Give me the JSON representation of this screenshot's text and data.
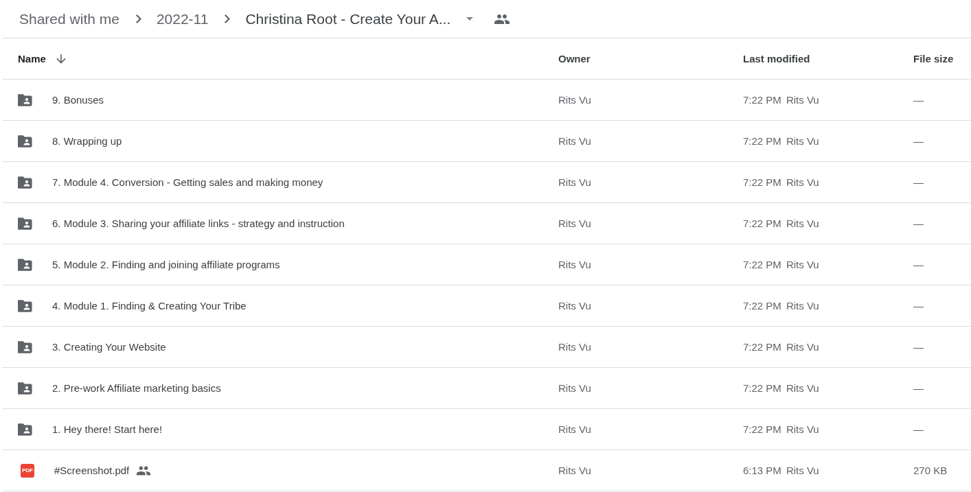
{
  "breadcrumbs": [
    {
      "label": "Shared with me",
      "current": false
    },
    {
      "label": "2022-11",
      "current": false
    },
    {
      "label": "Christina Root - Create Your A...",
      "current": true
    }
  ],
  "breadcrumb_shared": true,
  "table": {
    "columns": [
      {
        "label": "Name",
        "sorted": true
      },
      {
        "label": "Owner",
        "sorted": false
      },
      {
        "label": "Last modified",
        "sorted": false
      },
      {
        "label": "File size",
        "sorted": false
      }
    ],
    "rows": [
      {
        "kind": "folder",
        "name": "9. Bonuses",
        "shared": false,
        "owner": "Rits Vu",
        "modified_time": "7:22 PM",
        "modified_by": "Rits Vu",
        "size": "—"
      },
      {
        "kind": "folder",
        "name": "8. Wrapping up",
        "shared": false,
        "owner": "Rits Vu",
        "modified_time": "7:22 PM",
        "modified_by": "Rits Vu",
        "size": "—"
      },
      {
        "kind": "folder",
        "name": "7. Module 4. Conversion - Getting sales and making money",
        "shared": false,
        "owner": "Rits Vu",
        "modified_time": "7:22 PM",
        "modified_by": "Rits Vu",
        "size": "—"
      },
      {
        "kind": "folder",
        "name": "6. Module 3. Sharing your affiliate links - strategy and instruction",
        "shared": false,
        "owner": "Rits Vu",
        "modified_time": "7:22 PM",
        "modified_by": "Rits Vu",
        "size": "—"
      },
      {
        "kind": "folder",
        "name": "5. Module 2. Finding and joining affiliate programs",
        "shared": false,
        "owner": "Rits Vu",
        "modified_time": "7:22 PM",
        "modified_by": "Rits Vu",
        "size": "—"
      },
      {
        "kind": "folder",
        "name": "4. Module 1. Finding & Creating Your Tribe",
        "shared": false,
        "owner": "Rits Vu",
        "modified_time": "7:22 PM",
        "modified_by": "Rits Vu",
        "size": "—"
      },
      {
        "kind": "folder",
        "name": "3. Creating Your Website",
        "shared": false,
        "owner": "Rits Vu",
        "modified_time": "7:22 PM",
        "modified_by": "Rits Vu",
        "size": "—"
      },
      {
        "kind": "folder",
        "name": "2. Pre-work Affiliate marketing basics",
        "shared": false,
        "owner": "Rits Vu",
        "modified_time": "7:22 PM",
        "modified_by": "Rits Vu",
        "size": "—"
      },
      {
        "kind": "folder",
        "name": "1. Hey there! Start here!",
        "shared": false,
        "owner": "Rits Vu",
        "modified_time": "7:22 PM",
        "modified_by": "Rits Vu",
        "size": "—"
      },
      {
        "kind": "pdf",
        "badge": "PDF",
        "name": "#Screenshot.pdf",
        "shared": true,
        "owner": "Rits Vu",
        "modified_time": "6:13 PM",
        "modified_by": "Rits Vu",
        "size": "270 KB"
      }
    ]
  }
}
